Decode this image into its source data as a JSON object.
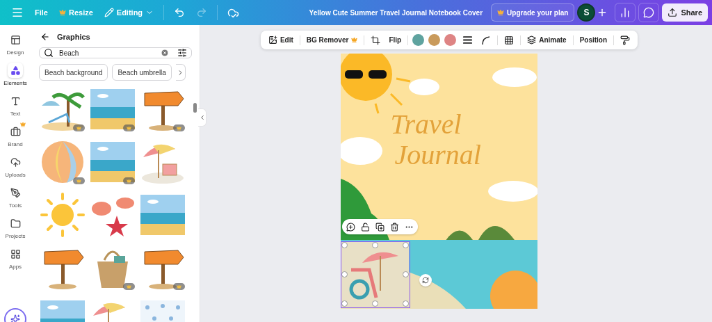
{
  "topbar": {
    "file": "File",
    "resize": "Resize",
    "mode": "Editing",
    "title": "Yellow Cute Summer Travel Journal Notebook Cover",
    "upgrade": "Upgrade your plan",
    "avatar": "S",
    "share": "Share"
  },
  "sidebar": {
    "items": [
      {
        "label": "Design",
        "selected": false,
        "premium": false
      },
      {
        "label": "Elements",
        "selected": true,
        "premium": false
      },
      {
        "label": "Text",
        "selected": false,
        "premium": false
      },
      {
        "label": "Brand",
        "selected": false,
        "premium": true
      },
      {
        "label": "Uploads",
        "selected": false,
        "premium": false
      },
      {
        "label": "Tools",
        "selected": false,
        "premium": false
      },
      {
        "label": "Projects",
        "selected": false,
        "premium": false
      },
      {
        "label": "Apps",
        "selected": false,
        "premium": false
      }
    ]
  },
  "panel": {
    "title": "Graphics",
    "search": {
      "value": "Beach"
    },
    "chips": [
      "Beach background",
      "Beach umbrella"
    ],
    "graphics": [
      {
        "kind": "palm",
        "premium": true
      },
      {
        "kind": "scene",
        "premium": true
      },
      {
        "kind": "sign",
        "premium": true
      },
      {
        "kind": "ball",
        "premium": true
      },
      {
        "kind": "scene",
        "premium": true
      },
      {
        "kind": "umbrella",
        "premium": false
      },
      {
        "kind": "sun",
        "premium": false
      },
      {
        "kind": "shells",
        "premium": false
      },
      {
        "kind": "scene",
        "premium": false
      },
      {
        "kind": "sign",
        "premium": false
      },
      {
        "kind": "basket",
        "premium": true
      },
      {
        "kind": "sign",
        "premium": true
      },
      {
        "kind": "scene",
        "premium": false
      },
      {
        "kind": "umbrella",
        "premium": false
      },
      {
        "kind": "pattern",
        "premium": false
      }
    ]
  },
  "toolbar": {
    "edit": "Edit",
    "bg_remover": {
      "label": "BG Remover",
      "premium": true
    },
    "flip": "Flip",
    "colors": [
      {
        "color": "#5fa39f"
      },
      {
        "color": "#c99a5b"
      },
      {
        "color": "#de8484"
      }
    ],
    "animate": "Animate",
    "position": "Position"
  },
  "design": {
    "title_lines": [
      "Travel",
      "Journal"
    ]
  }
}
